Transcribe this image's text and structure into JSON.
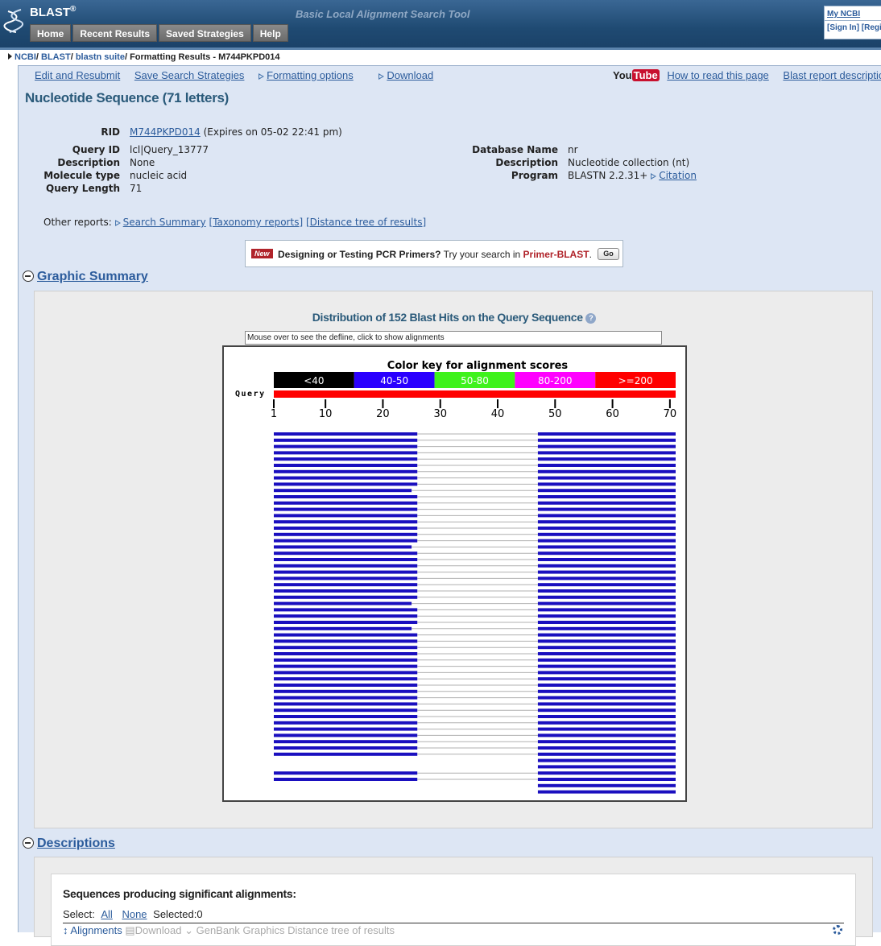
{
  "header": {
    "logo": "BLAST",
    "logo_mark": "®",
    "tagline": "Basic Local Alignment Search Tool",
    "tabs": [
      "Home",
      "Recent Results",
      "Saved Strategies",
      "Help"
    ],
    "my_ncbi": "My NCBI",
    "sign_in": "[Sign In] [Register]"
  },
  "breadcrumb": {
    "items": [
      "NCBI",
      "BLAST",
      "blastn suite"
    ],
    "current": "Formatting Results - M744PKPD014"
  },
  "toolbar": {
    "edit": "Edit and Resubmit",
    "save": "Save Search Strategies",
    "formatting": "Formatting options",
    "download": "Download",
    "youtube_you": "You",
    "youtube_tube": "Tube",
    "how_to": "How to read this page",
    "report_desc": "Blast report description"
  },
  "title": "Nucleotide Sequence (71 letters)",
  "info": {
    "rid_label": "RID",
    "rid": "M744PKPD014",
    "rid_expires": "(Expires on 05-02 22:41 pm)",
    "query_id_label": "Query ID",
    "query_id": "lcl|Query_13777",
    "description_label": "Description",
    "description": "None",
    "molecule_type_label": "Molecule type",
    "molecule_type": "nucleic acid",
    "query_length_label": "Query Length",
    "query_length": "71",
    "db_name_label": "Database Name",
    "db_name": "nr",
    "db_description_label": "Description",
    "db_description": "Nucleotide collection (nt)",
    "program_label": "Program",
    "program": "BLASTN 2.2.31+",
    "citation": "Citation"
  },
  "other_reports": {
    "label": "Other reports:",
    "search_summary": "Search Summary",
    "taxonomy": "[Taxonomy reports]",
    "distance_tree": "[Distance tree of results]"
  },
  "primer": {
    "badge": "New",
    "bold": "Designing or Testing PCR Primers?",
    "text": "Try your search in",
    "link": "Primer-BLAST",
    "go": "Go"
  },
  "graphic_summary": {
    "heading": "Graphic Summary",
    "dist_title": "Distribution of 152 Blast Hits on the Query Sequence",
    "help": "?",
    "mouse_over": "Mouse over to see the defline, click to show alignments"
  },
  "chart_data": {
    "type": "alignment-hits",
    "title": "Color key for alignment scores",
    "query_label": "Query",
    "query_length": 71,
    "score_bins": [
      {
        "label": "<40",
        "color": "#000000"
      },
      {
        "label": "40-50",
        "color": "#2a00ff"
      },
      {
        "label": "50-80",
        "color": "#3ff21c"
      },
      {
        "label": "80-200",
        "color": "#ff00ff"
      },
      {
        "label": ">=200",
        "color": "#ff0000"
      }
    ],
    "ticks": [
      1,
      10,
      20,
      30,
      40,
      50,
      60,
      70
    ],
    "hit_color": "#1a0fbf",
    "connector_color": "#b0b0b0",
    "rows": [
      {
        "l": [
          1,
          26
        ],
        "r": [
          47,
          71
        ]
      },
      {
        "l": [
          1,
          26
        ],
        "r": [
          47,
          71
        ]
      },
      {
        "l": [
          1,
          26
        ],
        "r": [
          47,
          71
        ]
      },
      {
        "l": [
          1,
          26
        ],
        "r": [
          47,
          71
        ]
      },
      {
        "l": [
          1,
          26
        ],
        "r": [
          47,
          71
        ]
      },
      {
        "l": [
          1,
          26
        ],
        "r": [
          47,
          71
        ]
      },
      {
        "l": [
          1,
          26
        ],
        "r": [
          47,
          71
        ]
      },
      {
        "l": [
          1,
          26
        ],
        "r": [
          47,
          71
        ]
      },
      {
        "l": [
          1,
          26
        ],
        "r": [
          47,
          71
        ]
      },
      {
        "l": [
          1,
          25
        ],
        "r": [
          47,
          71
        ]
      },
      {
        "l": [
          1,
          26
        ],
        "r": [
          47,
          71
        ]
      },
      {
        "l": [
          1,
          26
        ],
        "r": [
          47,
          71
        ]
      },
      {
        "l": [
          1,
          26
        ],
        "r": [
          47,
          71
        ]
      },
      {
        "l": [
          1,
          26
        ],
        "r": [
          47,
          71
        ]
      },
      {
        "l": [
          1,
          26
        ],
        "r": [
          47,
          71
        ]
      },
      {
        "l": [
          1,
          26
        ],
        "r": [
          47,
          71
        ]
      },
      {
        "l": [
          1,
          26
        ],
        "r": [
          47,
          71
        ]
      },
      {
        "l": [
          1,
          26
        ],
        "r": [
          47,
          71
        ]
      },
      {
        "l": [
          1,
          25
        ],
        "r": [
          47,
          71
        ]
      },
      {
        "l": [
          1,
          26
        ],
        "r": [
          47,
          71
        ]
      },
      {
        "l": [
          1,
          26
        ],
        "r": [
          47,
          71
        ]
      },
      {
        "l": [
          1,
          26
        ],
        "r": [
          47,
          71
        ]
      },
      {
        "l": [
          1,
          26
        ],
        "r": [
          47,
          71
        ]
      },
      {
        "l": [
          1,
          26
        ],
        "r": [
          47,
          71
        ]
      },
      {
        "l": [
          1,
          26
        ],
        "r": [
          47,
          71
        ]
      },
      {
        "l": [
          1,
          26
        ],
        "r": [
          47,
          71
        ]
      },
      {
        "l": [
          1,
          26
        ],
        "r": [
          47,
          71
        ]
      },
      {
        "l": [
          1,
          25
        ],
        "r": [
          47,
          71
        ]
      },
      {
        "l": [
          1,
          26
        ],
        "r": [
          47,
          71
        ]
      },
      {
        "l": [
          1,
          26
        ],
        "r": [
          47,
          71
        ]
      },
      {
        "l": [
          1,
          26
        ],
        "r": [
          47,
          71
        ]
      },
      {
        "l": [
          1,
          25
        ],
        "r": [
          47,
          71
        ]
      },
      {
        "l": [
          1,
          26
        ],
        "r": [
          47,
          71
        ]
      },
      {
        "l": [
          1,
          26
        ],
        "r": [
          47,
          71
        ]
      },
      {
        "l": [
          1,
          26
        ],
        "r": [
          47,
          71
        ]
      },
      {
        "l": [
          1,
          26
        ],
        "r": [
          47,
          71
        ]
      },
      {
        "l": [
          1,
          26
        ],
        "r": [
          47,
          71
        ]
      },
      {
        "l": [
          1,
          26
        ],
        "r": [
          47,
          71
        ]
      },
      {
        "l": [
          1,
          26
        ],
        "r": [
          47,
          71
        ]
      },
      {
        "l": [
          1,
          26
        ],
        "r": [
          47,
          71
        ]
      },
      {
        "l": [
          1,
          26
        ],
        "r": [
          47,
          71
        ]
      },
      {
        "l": [
          1,
          26
        ],
        "r": [
          47,
          71
        ]
      },
      {
        "l": [
          1,
          26
        ],
        "r": [
          47,
          71
        ]
      },
      {
        "l": [
          1,
          26
        ],
        "r": [
          47,
          71
        ]
      },
      {
        "l": [
          1,
          26
        ],
        "r": [
          47,
          71
        ]
      },
      {
        "l": [
          1,
          26
        ],
        "r": [
          47,
          71
        ]
      },
      {
        "l": [
          1,
          26
        ],
        "r": [
          47,
          71
        ]
      },
      {
        "l": [
          1,
          26
        ],
        "r": [
          47,
          71
        ]
      },
      {
        "l": [
          1,
          26
        ],
        "r": [
          47,
          71
        ]
      },
      {
        "l": [
          1,
          26
        ],
        "r": [
          47,
          71
        ]
      },
      {
        "l": [
          1,
          26
        ],
        "r": [
          47,
          71
        ]
      },
      {
        "l": [
          1,
          26
        ],
        "r": [
          47,
          71
        ]
      },
      {
        "l": null,
        "r": [
          47,
          71
        ]
      },
      {
        "l": null,
        "r": [
          47,
          71
        ]
      },
      {
        "l": [
          1,
          26
        ],
        "r": [
          47,
          71
        ]
      },
      {
        "l": [
          1,
          26
        ],
        "r": [
          47,
          71
        ]
      },
      {
        "l": null,
        "r": [
          47,
          71
        ]
      },
      {
        "l": null,
        "r": [
          47,
          71
        ]
      }
    ]
  },
  "descriptions": {
    "heading": "Descriptions",
    "title": "Sequences producing significant alignments:",
    "select_label": "Select:",
    "all": "All",
    "none": "None",
    "selected": "Selected:0",
    "alignments": "Alignments",
    "download": "Download",
    "genbank": "GenBank",
    "graphics": "Graphics",
    "distance_tree": "Distance tree of results"
  }
}
